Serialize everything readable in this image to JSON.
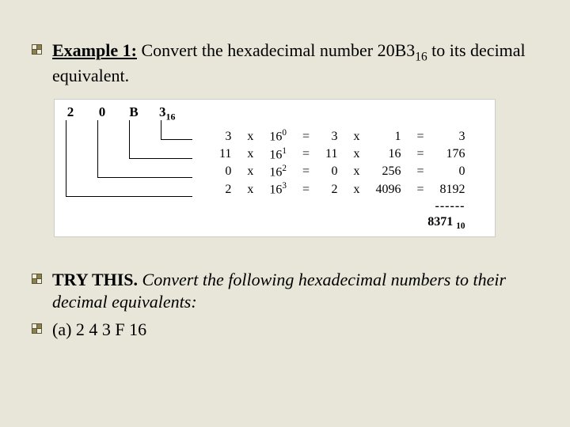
{
  "example": {
    "label": "Example 1:",
    "text_before": " Convert the hexadecimal number 20B3",
    "sub": "16",
    "text_after": " to its decimal equivalent."
  },
  "digits": {
    "d0": "2",
    "d1": "0",
    "d2": "B",
    "d3": "3",
    "sub": "16"
  },
  "rows": [
    {
      "a": "3",
      "x1": "x",
      "pb": "16",
      "pe": "0",
      "eq1": "=",
      "c": "3",
      "x2": "x",
      "m": "1",
      "eq2": "=",
      "r": "3"
    },
    {
      "a": "11",
      "x1": "x",
      "pb": "16",
      "pe": "1",
      "eq1": "=",
      "c": "11",
      "x2": "x",
      "m": "16",
      "eq2": "=",
      "r": "176"
    },
    {
      "a": "0",
      "x1": "x",
      "pb": "16",
      "pe": "2",
      "eq1": "=",
      "c": "0",
      "x2": "x",
      "m": "256",
      "eq2": "=",
      "r": "0"
    },
    {
      "a": "2",
      "x1": "x",
      "pb": "16",
      "pe": "3",
      "eq1": "=",
      "c": "2",
      "x2": "x",
      "m": "4096",
      "eq2": "=",
      "r": "8192"
    }
  ],
  "dashes": "------",
  "result": {
    "val": "8371",
    "sub": "10"
  },
  "trythis": {
    "label": "TRY THIS.",
    "text": " Convert the following hexadecimal numbers to their decimal equivalents:"
  },
  "part_a": "(a) 2 4 3 F 16"
}
